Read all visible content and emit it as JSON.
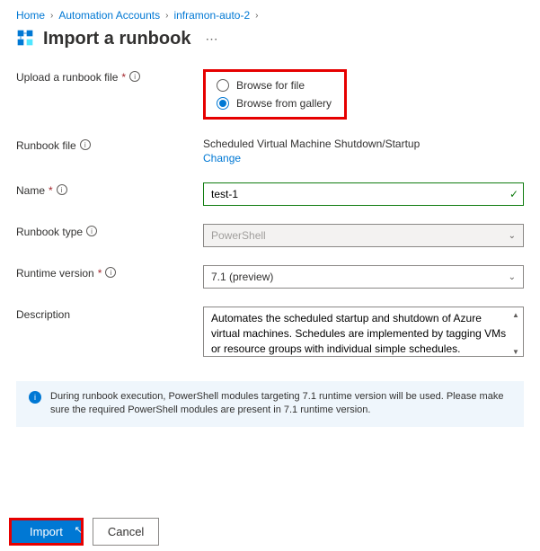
{
  "breadcrumb": {
    "home": "Home",
    "automation": "Automation Accounts",
    "account": "inframon-auto-2"
  },
  "page": {
    "title": "Import a runbook"
  },
  "upload": {
    "label": "Upload a runbook file",
    "option_file": "Browse for file",
    "option_gallery": "Browse from gallery"
  },
  "runbook_file": {
    "label": "Runbook file",
    "value": "Scheduled Virtual Machine Shutdown/Startup",
    "change": "Change"
  },
  "name": {
    "label": "Name",
    "value": "test-1"
  },
  "runbook_type": {
    "label": "Runbook type",
    "value": "PowerShell"
  },
  "runtime": {
    "label": "Runtime version",
    "value": "7.1 (preview)"
  },
  "description": {
    "label": "Description",
    "value": "Automates the scheduled startup and shutdown of Azure virtual machines. Schedules are implemented by tagging VMs or resource groups with individual simple schedules. Schedules can define multiple"
  },
  "callout": {
    "text": "During runbook execution, PowerShell modules targeting 7.1 runtime version will be used. Please make sure the required PowerShell modules are present in 7.1 runtime version."
  },
  "footer": {
    "import": "Import",
    "cancel": "Cancel"
  }
}
